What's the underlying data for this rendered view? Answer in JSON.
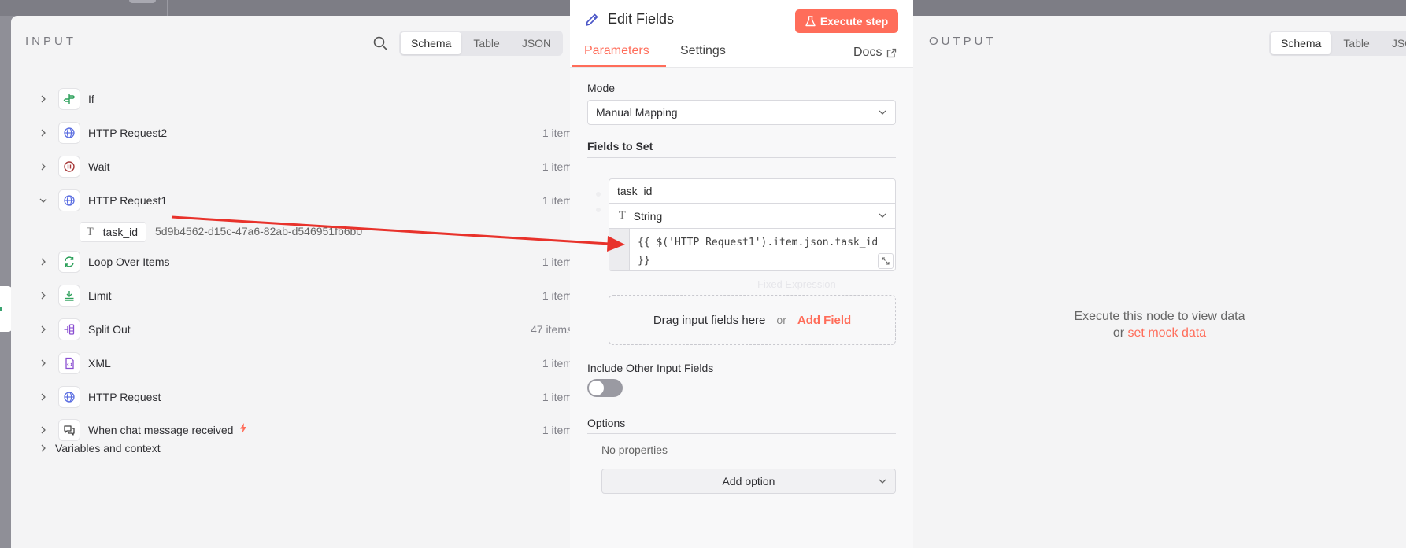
{
  "input": {
    "title": "INPUT",
    "tabs": [
      "Schema",
      "Table",
      "JSON"
    ],
    "active_tab": "Schema",
    "nodes": [
      {
        "label": "If",
        "count": "",
        "icon": "if-signpost-icon",
        "color": "#2ca05a"
      },
      {
        "label": "HTTP Request2",
        "count": "1 item",
        "icon": "globe-icon",
        "color": "#5b6ee1"
      },
      {
        "label": "Wait",
        "count": "1 item",
        "icon": "pause-circle-icon",
        "color": "#a83a3a"
      },
      {
        "label": "HTTP Request1",
        "count": "1 item",
        "icon": "globe-icon",
        "color": "#5b6ee1",
        "expanded": true
      },
      {
        "label": "Loop Over Items",
        "count": "1 item",
        "icon": "loop-arrows-icon",
        "color": "#2ca05a"
      },
      {
        "label": "Limit",
        "count": "1 item",
        "icon": "limit-icon",
        "color": "#2ca05a"
      },
      {
        "label": "Split Out",
        "count": "47 items",
        "icon": "split-out-icon",
        "color": "#8a4fd1"
      },
      {
        "label": "XML",
        "count": "1 item",
        "icon": "xml-file-icon",
        "color": "#8a4fd1"
      },
      {
        "label": "HTTP Request",
        "count": "1 item",
        "icon": "globe-icon",
        "color": "#5b6ee1"
      },
      {
        "label": "When chat message received",
        "count": "1 item",
        "icon": "chat-icon",
        "color": "#444444",
        "trigger": true
      }
    ],
    "field": {
      "name": "task_id",
      "value": "5d9b4562-d15c-47a6-82ab-d546951fb6b0"
    },
    "variables_label": "Variables and context"
  },
  "edit": {
    "title": "Edit Fields",
    "execute_label": "Execute step",
    "tabs": {
      "parameters": "Parameters",
      "settings": "Settings",
      "docs": "Docs"
    },
    "mode_label": "Mode",
    "mode_value": "Manual Mapping",
    "fields_to_set_label": "Fields to Set",
    "field_name": "task_id",
    "field_type": "String",
    "field_expression": "{{ $('HTTP Request1').item.json.task_id }}",
    "field_mode_hint": "Fixed  Expression",
    "drop_text": "Drag input fields here",
    "or": "or",
    "add_field": "Add Field",
    "include_other_label": "Include Other Input Fields",
    "include_other_on": false,
    "options_label": "Options",
    "no_properties": "No properties",
    "add_option": "Add option"
  },
  "output": {
    "title": "OUTPUT",
    "tabs": [
      "Schema",
      "Table",
      "JSON"
    ],
    "active_tab": "Schema",
    "message_line1": "Execute this node to view data",
    "message_or": "or",
    "message_link": "set mock data"
  },
  "colors": {
    "accent": "#ff6d5a",
    "arrow": "#e8322b"
  }
}
